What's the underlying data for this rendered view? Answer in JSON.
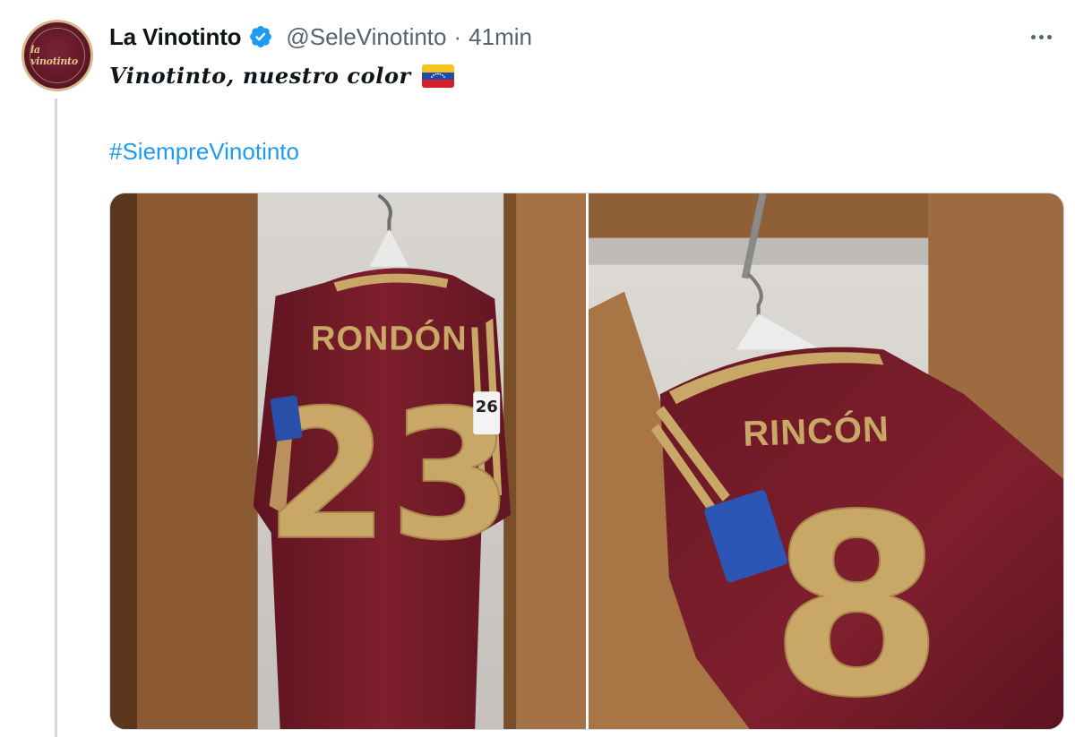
{
  "tweet": {
    "author": {
      "display_name": "La Vinotinto",
      "handle": "@SeleVinotinto",
      "avatar_text": "la vinotinto",
      "verified": true
    },
    "separator": "·",
    "time": "41min",
    "text": "Vinotinto, nuestro color",
    "flag_icon": "venezuela-flag-icon",
    "hashtag": "#SiempreVinotinto",
    "colors": {
      "link": "#1d9bf0",
      "handle": "#536471",
      "verified": "#1d9bf0",
      "jersey": "#7b1f2b",
      "jersey_trim": "#c9a766"
    },
    "media": [
      {
        "name": "RONDÓN",
        "number": "23"
      },
      {
        "name": "RINCÓN",
        "number": "8"
      }
    ]
  }
}
